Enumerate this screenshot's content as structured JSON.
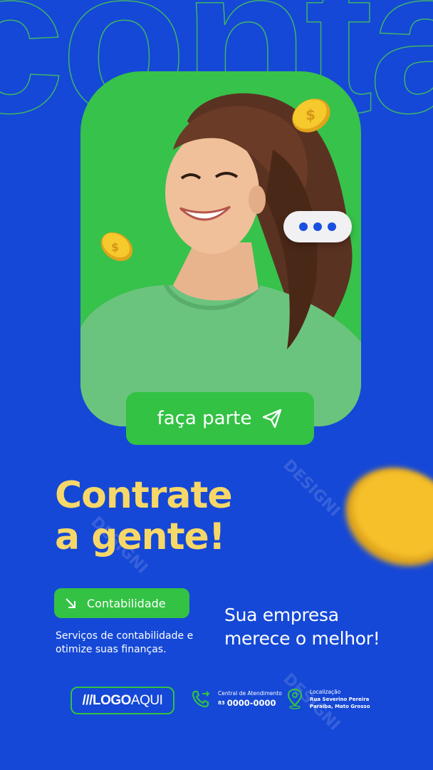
{
  "background_word": "contabil",
  "watermark": "DESIGNI",
  "cta": {
    "label": "faça parte",
    "icon": "paper-plane-icon"
  },
  "headline": {
    "line1": "Contrate",
    "line2": "a gente!"
  },
  "service_pill": {
    "label": "Contabilidade",
    "icon": "arrow-down-right-icon"
  },
  "description": "Serviços de contabilidade e otimize suas finanças.",
  "tagline": {
    "line1": "Sua empresa",
    "line2": "merece o melhor!"
  },
  "logo": {
    "slashes": "///",
    "part1": "LOGO",
    "part2": "AQUI"
  },
  "contact": {
    "label": "Central de Atendimento",
    "area_code": "83",
    "number": "0000-0000",
    "icon": "phone-transfer-icon"
  },
  "location": {
    "label": "Localização",
    "line1": "Rua Severino Pereira",
    "line2": "Paraíba, Mato Grosso",
    "icon": "map-pin-icon"
  },
  "colors": {
    "background": "#1548d6",
    "green": "#33c244",
    "yellow": "#f7d768",
    "white": "#ffffff"
  }
}
